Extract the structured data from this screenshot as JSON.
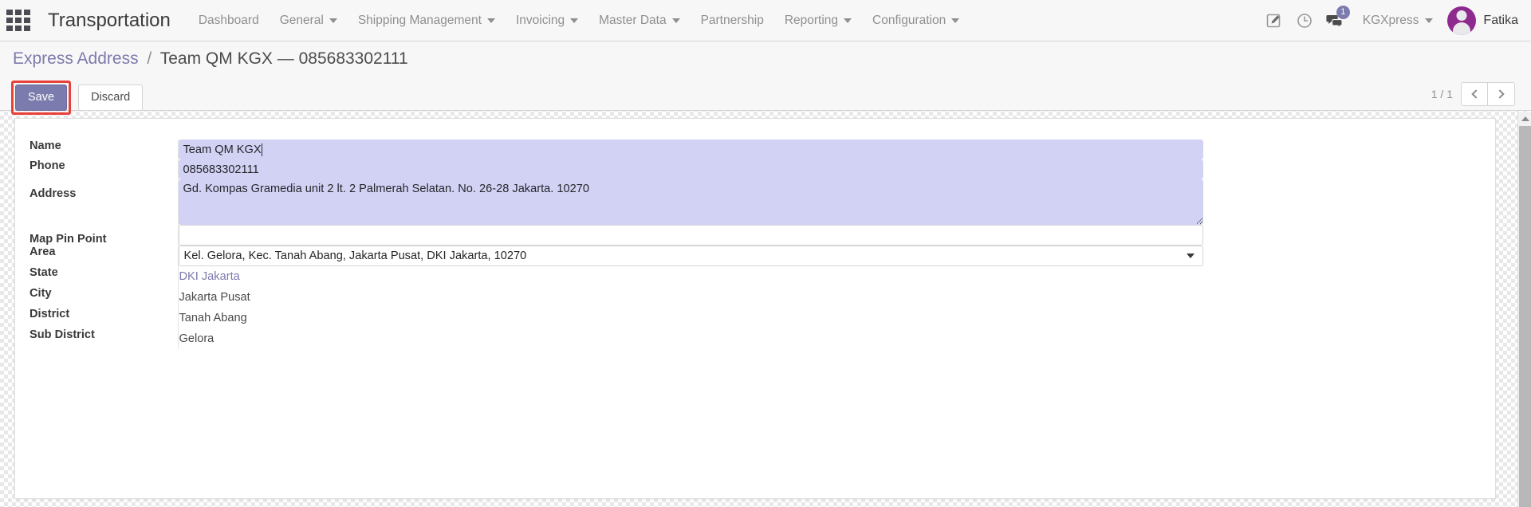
{
  "navbar": {
    "apps_icon": "apps-grid-icon",
    "brand": "Transportation",
    "menu": [
      {
        "label": "Dashboard",
        "has_caret": false
      },
      {
        "label": "General",
        "has_caret": true
      },
      {
        "label": "Shipping Management",
        "has_caret": true
      },
      {
        "label": "Invoicing",
        "has_caret": true
      },
      {
        "label": "Master Data",
        "has_caret": true
      },
      {
        "label": "Partnership",
        "has_caret": false
      },
      {
        "label": "Reporting",
        "has_caret": true
      },
      {
        "label": "Configuration",
        "has_caret": true
      }
    ],
    "icons": {
      "edit": "edit-square-icon",
      "clock": "clock-icon",
      "messages": "chat-bubbles-icon"
    },
    "message_badge": "1",
    "database_menu": "KGXpress",
    "user_name": "Fatika"
  },
  "control_panel": {
    "breadcrumb_root": "Express Address",
    "breadcrumb_sep": "/",
    "breadcrumb_current": "Team QM KGX — 085683302111",
    "save_label": "Save",
    "discard_label": "Discard",
    "pager_count": "1 / 1",
    "prev_icon": "chevron-left-icon",
    "next_icon": "chevron-right-icon",
    "highlight_color": "#e8403a",
    "accent_color": "#7c7bad"
  },
  "form": {
    "fields": {
      "name": {
        "label": "Name",
        "value": "Team QM KGX"
      },
      "phone": {
        "label": "Phone",
        "value": "085683302111"
      },
      "address": {
        "label": "Address",
        "value": "Gd. Kompas Gramedia unit 2 lt. 2 Palmerah Selatan. No. 26-28 Jakarta. 10270"
      },
      "map_pin_point": {
        "label": "Map Pin Point",
        "value": "",
        "placeholder": ""
      },
      "area": {
        "label": "Area",
        "value": "Kel. Gelora, Kec. Tanah Abang, Jakarta Pusat, DKI Jakarta, 10270"
      },
      "state": {
        "label": "State",
        "value": "DKI Jakarta"
      },
      "city": {
        "label": "City",
        "value": "Jakarta Pusat"
      },
      "district": {
        "label": "District",
        "value": "Tanah Abang"
      },
      "sub_district": {
        "label": "Sub District",
        "value": "Gelora"
      }
    }
  },
  "scrollbar": {
    "up_icon": "scroll-up-arrow-icon"
  }
}
